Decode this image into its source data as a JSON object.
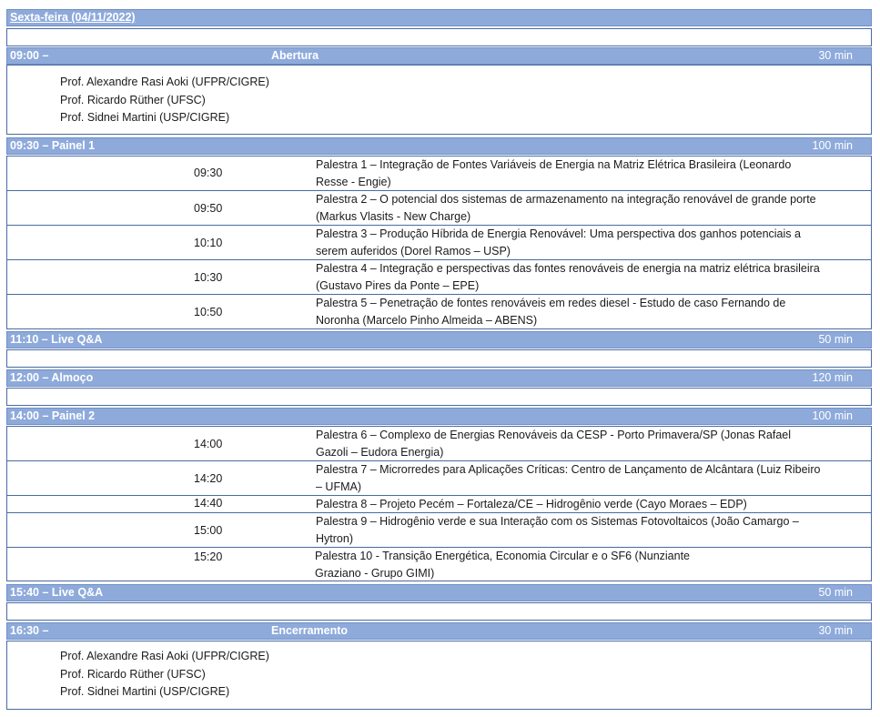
{
  "day_title": "Sexta-feira  (04/11/2022)",
  "blocks": [
    {
      "id": "abertura",
      "left": "09:00 –",
      "center": "Abertura",
      "duration": "30 min",
      "people": [
        "Prof. Alexandre Rasi Aoki (UFPR/CIGRE)",
        "Prof. Ricardo Rüther (UFSC)",
        "Prof. Sidnei Martini (USP/CIGRE)"
      ]
    },
    {
      "id": "painel1",
      "left": "09:30 – Painel 1",
      "center": "",
      "duration": "100 min",
      "talks": [
        {
          "time": "09:30",
          "text": "Palestra 1 – Integração de Fontes Variáveis de Energia na Matriz Elétrica Brasileira (Leonardo Resse - Engie)"
        },
        {
          "time": "09:50",
          "text": "Palestra 2 – O potencial dos sistemas de armazenamento na integração renovável de grande porte (Markus Vlasits - New Charge)"
        },
        {
          "time": "10:10",
          "text": "Palestra 3 – Produção Híbrida de Energia Renovável: Uma perspectiva dos ganhos potenciais a serem auferidos (Dorel Ramos – USP)"
        },
        {
          "time": "10:30",
          "text": "Palestra 4 – Integração e perspectivas das fontes renováveis de energia na matriz elétrica brasileira (Gustavo Pires da Ponte – EPE)"
        },
        {
          "time": "10:50",
          "text": "Palestra 5 – Penetração de fontes renováveis em redes diesel - Estudo de caso Fernando de Noronha (Marcelo Pinho Almeida – ABENS)"
        }
      ]
    },
    {
      "id": "qa1",
      "left": "11:10 – Live Q&A",
      "center": "",
      "duration": "50 min"
    },
    {
      "id": "almoco",
      "left": "12:00 – Almoço",
      "center": "",
      "duration": "120 min"
    },
    {
      "id": "painel2",
      "left": "14:00 – Painel 2",
      "center": "",
      "duration": "100 min",
      "talks": [
        {
          "time": "14:00",
          "text": "Palestra 6 – Complexo de Energias Renováveis da CESP - Porto Primavera/SP (Jonas Rafael Gazoli – Eudora Energia)"
        },
        {
          "time": "14:20",
          "text": "Palestra 7 – Microrredes para Aplicações Críticas: Centro de Lançamento de Alcântara (Luiz Ribeiro – UFMA)"
        },
        {
          "time": "14:40",
          "text": "Palestra 8 – Projeto Pecém – Fortaleza/CE – Hidrogênio verde (Cayo Moraes – EDP)"
        },
        {
          "time": "15:00",
          "text": "Palestra 9 – Hidrogênio verde e sua Interação com os Sistemas Fotovoltaicos (João Camargo – Hytron)"
        },
        {
          "time": "15:20",
          "text": "Palestra 10 - Transição Energética, Economia Circular e o SF6 (Nunziante Graziano - Grupo GIMI)"
        }
      ]
    },
    {
      "id": "qa2",
      "left": "15:40 – Live Q&A",
      "center": "",
      "duration": "50 min"
    },
    {
      "id": "encerramento",
      "left": "16:30 –",
      "center": "Encerramento",
      "duration": "30 min",
      "people": [
        "Prof. Alexandre Rasi Aoki (UFPR/CIGRE)",
        "Prof. Ricardo Rüther (UFSC)",
        "Prof. Sidnei Martini (USP/CIGRE)"
      ]
    }
  ]
}
